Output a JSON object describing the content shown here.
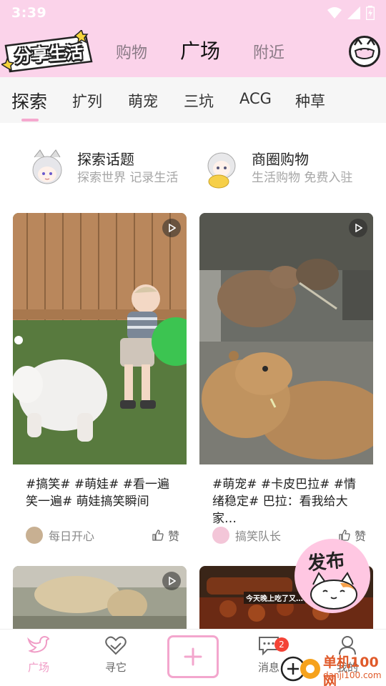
{
  "status_bar": {
    "time": "3:39"
  },
  "header": {
    "logo_text": "分享生活",
    "tabs": [
      {
        "label": "购物",
        "active": false
      },
      {
        "label": "广场",
        "active": true
      },
      {
        "label": "附近",
        "active": false
      }
    ]
  },
  "categories": [
    {
      "label": "探索",
      "active": true
    },
    {
      "label": "扩列"
    },
    {
      "label": "萌宠"
    },
    {
      "label": "三坑"
    },
    {
      "label": "ACG"
    },
    {
      "label": "种草"
    }
  ],
  "quick_entries": [
    {
      "title": "探索话题",
      "subtitle": "探索世界 记录生活"
    },
    {
      "title": "商圈购物",
      "subtitle": "生活购物 免费入驻"
    }
  ],
  "feed": [
    {
      "text": "#搞笑# #萌娃# #看一遍笑一遍# 萌娃搞笑瞬间",
      "author": "每日开心",
      "like_label": "赞",
      "type": "video"
    },
    {
      "text": "#萌宠# #卡皮巴拉# #情绪稳定# 巴拉：看我给大家…",
      "author": "搞笑队长",
      "like_label": "赞",
      "type": "video"
    },
    {
      "text": "",
      "author": "",
      "like_label": "",
      "type": "video"
    },
    {
      "text": "",
      "author": "",
      "like_label": "",
      "type": "video",
      "overlay_caption": "今天晚上吃了又…"
    }
  ],
  "publish": {
    "label": "发布"
  },
  "bottom_nav": [
    {
      "label": "广场",
      "icon": "bird-icon",
      "active": true
    },
    {
      "label": "寻它",
      "icon": "heart-hand-icon"
    },
    {
      "label": "",
      "icon": "plus-icon"
    },
    {
      "label": "消息",
      "icon": "chat-icon",
      "badge": "2"
    },
    {
      "label": "我的",
      "icon": "user-icon"
    }
  ],
  "watermark": {
    "text": "单机100网",
    "url": "danji100.com"
  },
  "colors": {
    "header_pink": "#fbd3ea",
    "accent_pink": "#f5a9cf",
    "badge_red": "#f44336"
  }
}
